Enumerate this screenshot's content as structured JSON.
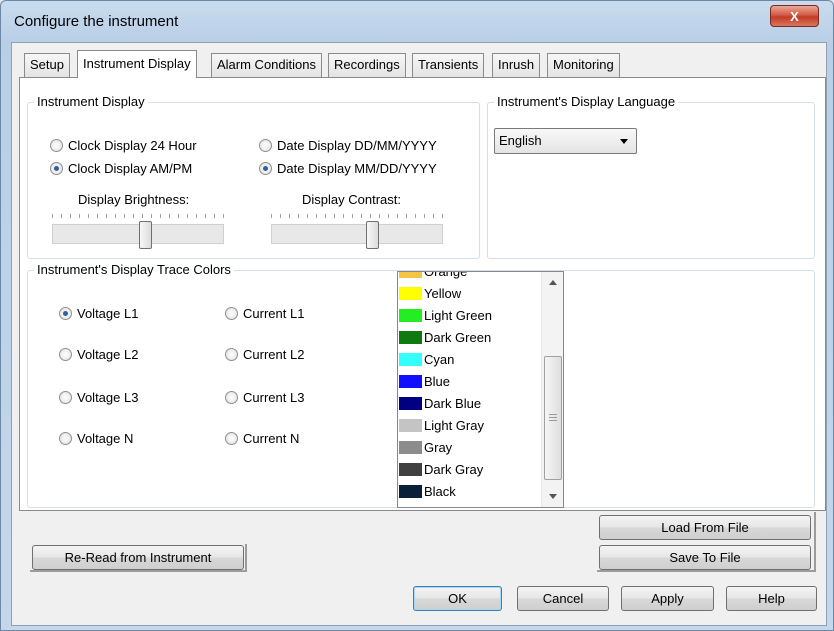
{
  "window": {
    "title": "Configure the instrument",
    "close_glyph": "X"
  },
  "tabs": [
    {
      "label": "Setup",
      "active": false
    },
    {
      "label": "Instrument Display",
      "active": true
    },
    {
      "label": "Alarm Conditions",
      "active": false
    },
    {
      "label": "Recordings",
      "active": false
    },
    {
      "label": "Transients",
      "active": false
    },
    {
      "label": "Inrush",
      "active": false
    },
    {
      "label": "Monitoring",
      "active": false
    }
  ],
  "instrument_display": {
    "group_title": "Instrument Display",
    "clock_24": {
      "label": "Clock Display 24 Hour",
      "selected": false
    },
    "clock_ampm": {
      "label": "Clock Display AM/PM",
      "selected": true
    },
    "date_ddmm": {
      "label": "Date Display DD/MM/YYYY",
      "selected": false
    },
    "date_mmdd": {
      "label": "Date Display MM/DD/YYYY",
      "selected": true
    },
    "brightness_label": "Display Brightness:",
    "contrast_label": "Display Contrast:",
    "brightness_level": 0.55,
    "contrast_level": 0.6
  },
  "language": {
    "group_title": "Instrument's Display Language",
    "selected": "English"
  },
  "trace_colors": {
    "group_title": "Instrument's Display Trace Colors",
    "radios": [
      {
        "label": "Voltage L1",
        "selected": true
      },
      {
        "label": "Voltage L2",
        "selected": false
      },
      {
        "label": "Voltage L3",
        "selected": false
      },
      {
        "label": "Voltage N",
        "selected": false
      },
      {
        "label": "Current L1",
        "selected": false
      },
      {
        "label": "Current L2",
        "selected": false
      },
      {
        "label": "Current L3",
        "selected": false
      },
      {
        "label": "Current N",
        "selected": false
      }
    ],
    "colors": [
      {
        "label": "Orange",
        "color": "#f5c542"
      },
      {
        "label": "Yellow",
        "color": "#ffff00"
      },
      {
        "label": "Light Green",
        "color": "#22ee22"
      },
      {
        "label": "Dark Green",
        "color": "#0f7a0f"
      },
      {
        "label": "Cyan",
        "color": "#33ffff"
      },
      {
        "label": "Blue",
        "color": "#1010ff"
      },
      {
        "label": "Dark Blue",
        "color": "#000080"
      },
      {
        "label": "Light Gray",
        "color": "#c4c4c4"
      },
      {
        "label": "Gray",
        "color": "#8c8c8c"
      },
      {
        "label": "Dark Gray",
        "color": "#404040"
      },
      {
        "label": "Black",
        "color": "#0a2038"
      }
    ]
  },
  "buttons": {
    "load_from_file": "Load From File",
    "save_to_file": "Save To File",
    "reread": "Re-Read from Instrument",
    "ok": "OK",
    "cancel": "Cancel",
    "apply": "Apply",
    "help": "Help"
  }
}
